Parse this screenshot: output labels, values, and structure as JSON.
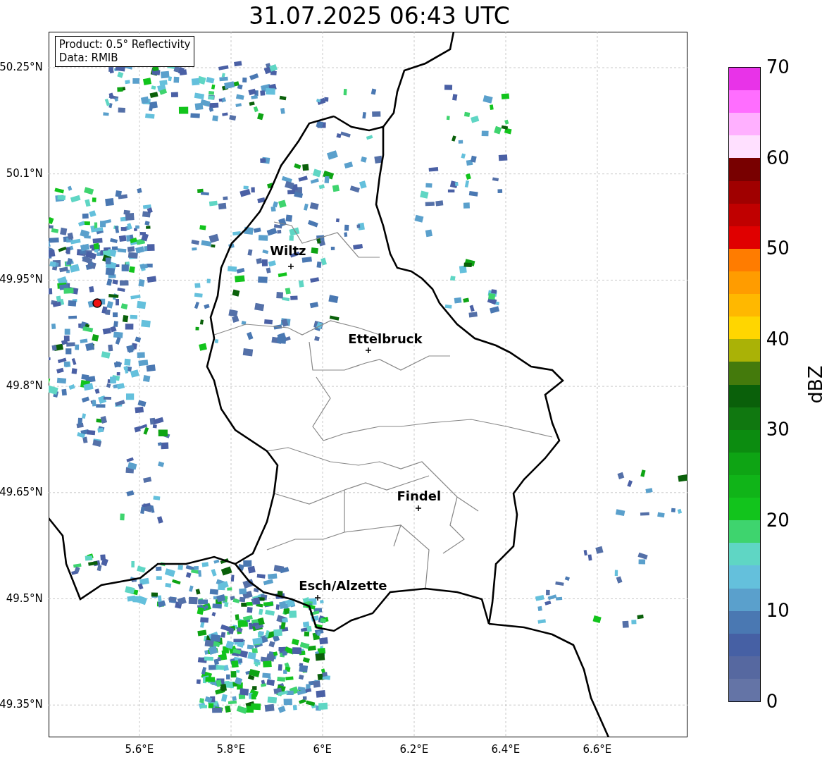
{
  "title": "31.07.2025 06:43 UTC",
  "legend": [
    "Product: 0.5° Reflectivity",
    "Data: RMIB"
  ],
  "cities": [
    {
      "name": "Wiltz"
    },
    {
      "name": "Ettelbruck"
    },
    {
      "name": "Findel"
    },
    {
      "name": "Esch/Alzette"
    }
  ],
  "lat_ticks": [
    "50.25°N",
    "50.1°N",
    "49.95°N",
    "49.8°N",
    "49.65°N",
    "49.5°N",
    "49.35°N"
  ],
  "lon_ticks": [
    "5.6°E",
    "5.8°E",
    "6°E",
    "6.2°E",
    "6.4°E",
    "6.6°E"
  ],
  "colorbar": {
    "label": "dBZ",
    "ticks": [
      "70",
      "60",
      "50",
      "40",
      "30",
      "20",
      "10",
      "0"
    ],
    "segments": [
      {
        "color": "#e833e8"
      },
      {
        "color": "#ff6eff"
      },
      {
        "color": "#ffb0ff"
      },
      {
        "color": "#ffe0ff"
      },
      {
        "color": "#780000"
      },
      {
        "color": "#a00000"
      },
      {
        "color": "#c00000"
      },
      {
        "color": "#e00000"
      },
      {
        "color": "#ff7c00"
      },
      {
        "color": "#ff9c00"
      },
      {
        "color": "#ffb800"
      },
      {
        "color": "#ffd600"
      },
      {
        "color": "#aab206"
      },
      {
        "color": "#447a0c"
      },
      {
        "color": "#0a600a"
      },
      {
        "color": "#107810"
      },
      {
        "color": "#0c8c10"
      },
      {
        "color": "#0ea414"
      },
      {
        "color": "#10b418"
      },
      {
        "color": "#12c41c"
      },
      {
        "color": "#3ed46e"
      },
      {
        "color": "#5fd6c4"
      },
      {
        "color": "#64c0dc"
      },
      {
        "color": "#5aa0cc"
      },
      {
        "color": "#4a78b2"
      },
      {
        "color": "#4660a4"
      },
      {
        "color": "#5668a0"
      },
      {
        "color": "#6474a6"
      }
    ]
  }
}
